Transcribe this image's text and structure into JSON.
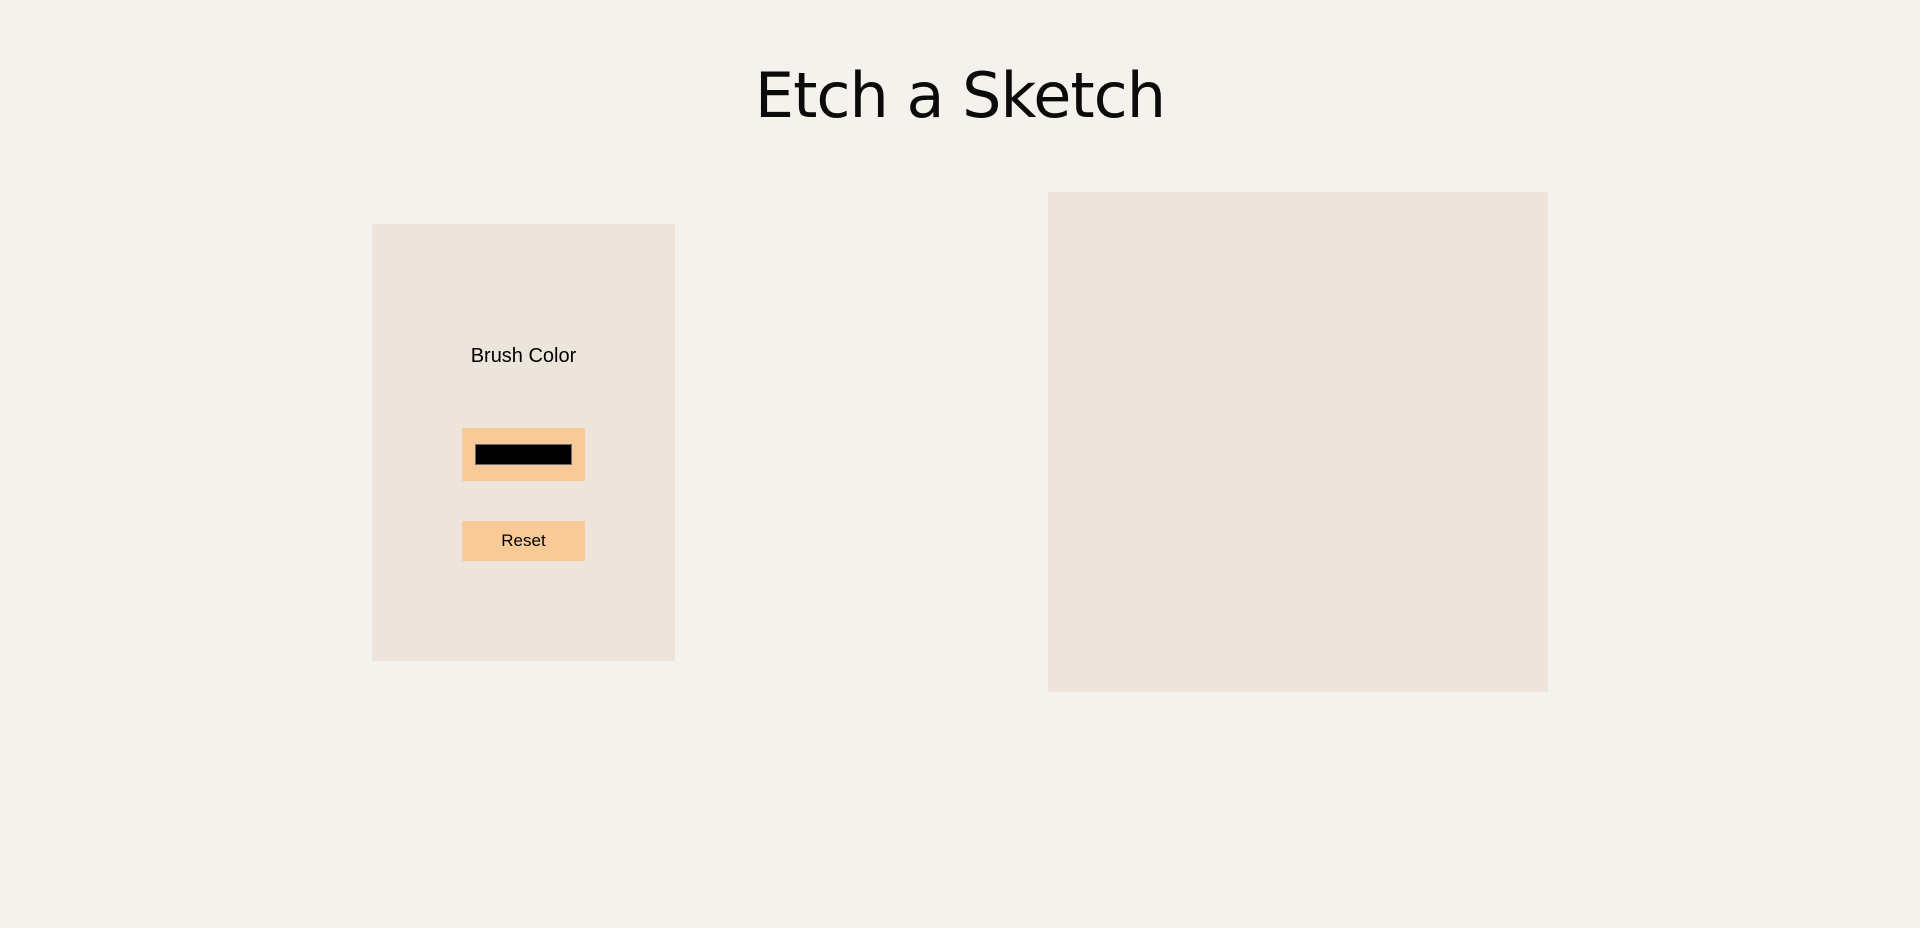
{
  "header": {
    "title": "Etch a Sketch"
  },
  "controls": {
    "brush_label": "Brush Color",
    "brush_color": "#000000",
    "reset_label": "Reset"
  },
  "colors": {
    "page_background": "#f5f2ed",
    "panel_background": "#ede5dc",
    "button_background": "#f7ca98",
    "canvas_background": "#ede5dc"
  }
}
